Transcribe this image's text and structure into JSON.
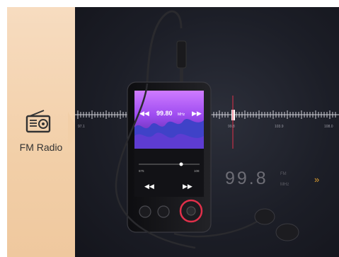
{
  "sidebar": {
    "label": "FM Radio",
    "icon": "radio-icon"
  },
  "scale": {
    "ticks": [
      "97.1",
      "99.8",
      "103.9",
      "108.0"
    ]
  },
  "device": {
    "frequency": "99.80",
    "unit": "MHz",
    "seek_back_icon": "rewind-icon",
    "seek_forward_icon": "fast-forward-icon",
    "slider_left": "875",
    "slider_right": "108"
  },
  "readout": {
    "frequency": "99.8",
    "unit_top": "FM",
    "unit_bottom": "MHz",
    "next_icon": "double-chevron-right-icon"
  },
  "colors": {
    "accent": "#e0304a",
    "panel": "#f2cfa8",
    "screen": "#b45cff",
    "background": "#1c1e27"
  }
}
